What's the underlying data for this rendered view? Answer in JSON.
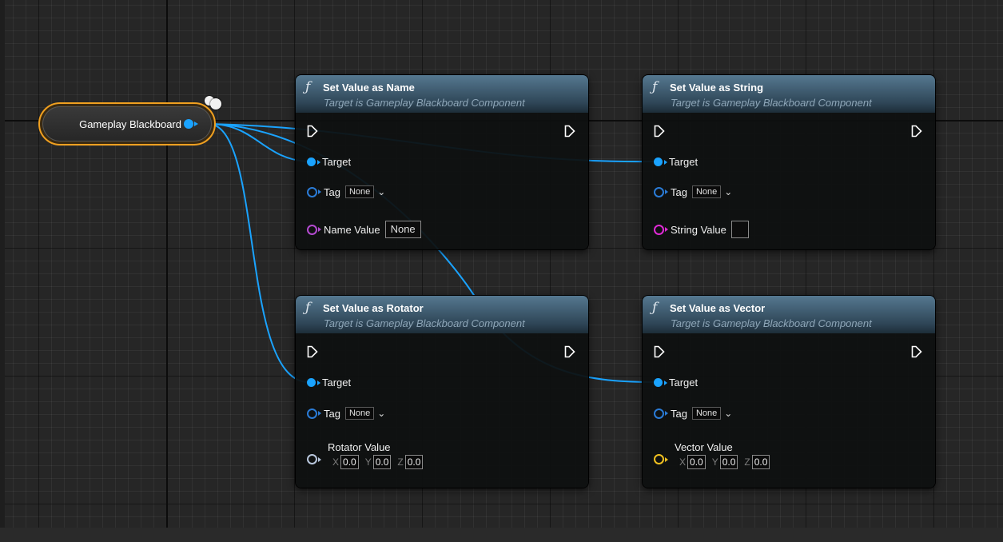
{
  "variable": {
    "label": "Gameplay Blackboard"
  },
  "colors": {
    "object_pin": "#1aa3ff",
    "name_pin": "#b44ad0",
    "string_pin": "#e02ad6",
    "rotator_pin": "#b8c6dc",
    "vector_pin": "#f0c020",
    "variable_outline": "#f0a020",
    "function_header": "#2e4556"
  },
  "icons": {
    "function": "function-icon",
    "exec": "exec-pin-icon",
    "comment": "comment-bubble-icon"
  },
  "nodes": {
    "set_name": {
      "fn_symbol": "ƒ",
      "title": "Set Value as Name",
      "subtitle": "Target is Gameplay Blackboard Component",
      "target_label": "Target",
      "tag_label": "Tag",
      "tag_value": "None",
      "value_label": "Name Value",
      "value": "None"
    },
    "set_string": {
      "fn_symbol": "ƒ",
      "title": "Set Value as String",
      "subtitle": "Target is Gameplay Blackboard Component",
      "target_label": "Target",
      "tag_label": "Tag",
      "tag_value": "None",
      "value_label": "String Value",
      "value": ""
    },
    "set_rotator": {
      "fn_symbol": "ƒ",
      "title": "Set Value as Rotator",
      "subtitle": "Target is Gameplay Blackboard Component",
      "target_label": "Target",
      "tag_label": "Tag",
      "tag_value": "None",
      "value_label": "Rotator Value",
      "x_label": "X",
      "x": "0.0",
      "y_label": "Y",
      "y": "0.0",
      "z_label": "Z",
      "z": "0.0"
    },
    "set_vector": {
      "fn_symbol": "ƒ",
      "title": "Set Value as Vector",
      "subtitle": "Target is Gameplay Blackboard Component",
      "target_label": "Target",
      "tag_label": "Tag",
      "tag_value": "None",
      "value_label": "Vector Value",
      "x_label": "X",
      "x": "0.0",
      "y_label": "Y",
      "y": "0.0",
      "z_label": "Z",
      "z": "0.0"
    }
  }
}
